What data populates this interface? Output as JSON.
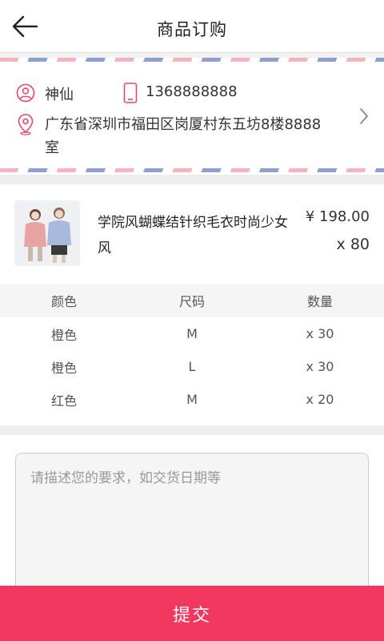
{
  "header": {
    "title": "商品订购"
  },
  "address": {
    "name": "神仙",
    "phone": "1368888888",
    "detail": "广东省深圳市福田区岗厦村东五坊8楼8888室"
  },
  "product": {
    "name": "学院风蝴蝶结针织毛衣时尚少女风",
    "price": "¥ 198.00",
    "quantity": "x 80"
  },
  "specs": {
    "headers": {
      "color": "颜色",
      "size": "尺码",
      "quantity": "数量"
    },
    "rows": [
      {
        "color": "橙色",
        "size": "M",
        "quantity": "x 30"
      },
      {
        "color": "橙色",
        "size": "L",
        "quantity": "x 30"
      },
      {
        "color": "红色",
        "size": "M",
        "quantity": "x 20"
      }
    ]
  },
  "note": {
    "placeholder": "请描述您的要求，如交货日期等"
  },
  "submit": {
    "label": "提交"
  },
  "colors": {
    "accent": "#f3385f",
    "icon": "#e8476a",
    "stripe_pink": "#f6b3bf",
    "stripe_blue": "#8fa1d4"
  }
}
